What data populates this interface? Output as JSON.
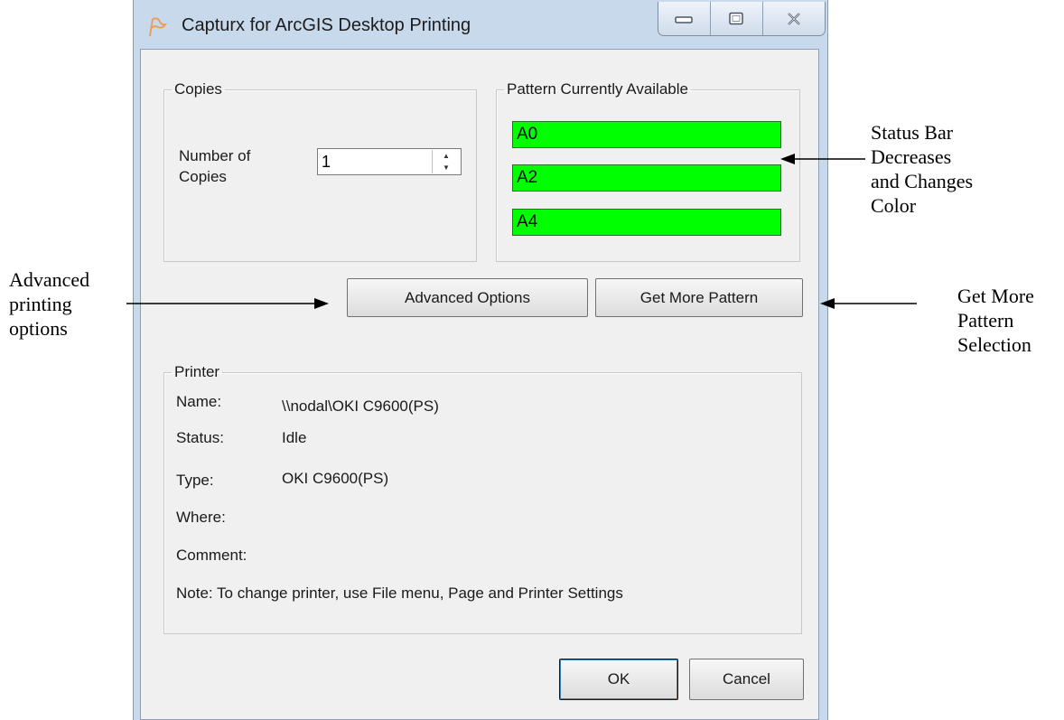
{
  "window": {
    "title": "Capturx for ArcGIS Desktop Printing",
    "icon": "capturx-flag-icon",
    "controls": [
      "minimize-icon",
      "maximize-icon",
      "close-icon"
    ]
  },
  "copies": {
    "group_label": "Copies",
    "number_label_line1": "Number  of",
    "number_label_line2": "Copies",
    "value": "1"
  },
  "pattern": {
    "group_label": "Pattern Currently Available",
    "bars": [
      {
        "label": "A0",
        "fill": 1.0,
        "color": "#00ff00"
      },
      {
        "label": "A2",
        "fill": 1.0,
        "color": "#00ff00"
      },
      {
        "label": "A4",
        "fill": 1.0,
        "color": "#00ff00"
      }
    ]
  },
  "buttons": {
    "advanced": "Advanced Options",
    "get_more": "Get More Pattern",
    "ok": "OK",
    "cancel": "Cancel"
  },
  "printer": {
    "group_label": "Printer",
    "name_label": "Name:",
    "name_value": "\\\\nodal\\OKI C9600(PS)",
    "status_label": "Status:",
    "status_value": "Idle",
    "type_label": "Type:",
    "type_value": "OKI C9600(PS)",
    "where_label": "Where:",
    "where_value": "",
    "comment_label": "Comment:",
    "comment_value": "",
    "note": "Note: To change printer, use File menu, Page and Printer Settings"
  },
  "annotations": {
    "status_bar": [
      "Status Bar",
      "Decreases",
      "and Changes",
      "Color"
    ],
    "advanced": [
      "Advanced",
      "printing",
      "options"
    ],
    "get_more": [
      "Get More",
      "Pattern",
      "Selection"
    ]
  }
}
